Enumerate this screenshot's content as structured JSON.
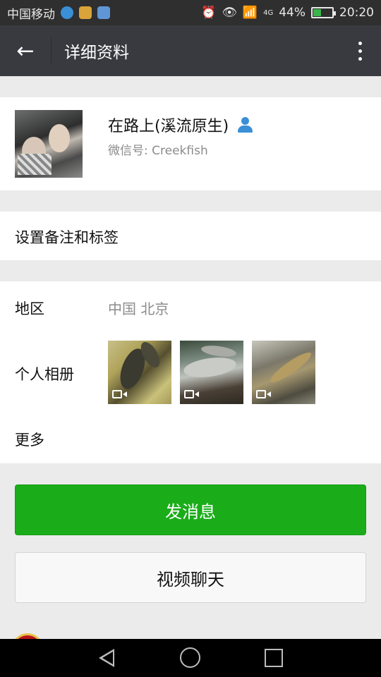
{
  "status_bar": {
    "carrier": "中国移动",
    "battery": "44%",
    "battery_level": 0.44,
    "time": "20:20",
    "network": "4G"
  },
  "header": {
    "title": "详细资料",
    "back_icon": "arrow-left-icon",
    "more_icon": "more-vertical-icon"
  },
  "profile": {
    "nickname": "在路上(溪流原生)",
    "wechat_id": "微信号: Creekfish",
    "contact_icon": "person-icon"
  },
  "remark": {
    "label": "设置备注和标签"
  },
  "info": {
    "region_label": "地区",
    "region_value": "中国  北京",
    "album_label": "个人相册",
    "album_items": [
      {
        "type": "video"
      },
      {
        "type": "video"
      },
      {
        "type": "video"
      }
    ],
    "more_label": "更多"
  },
  "actions": {
    "send_message": "发消息",
    "video_call": "视频聊天"
  },
  "colors": {
    "primary_green": "#1aad19",
    "header_bg": "#393a3f",
    "page_bg": "#ebebeb"
  }
}
